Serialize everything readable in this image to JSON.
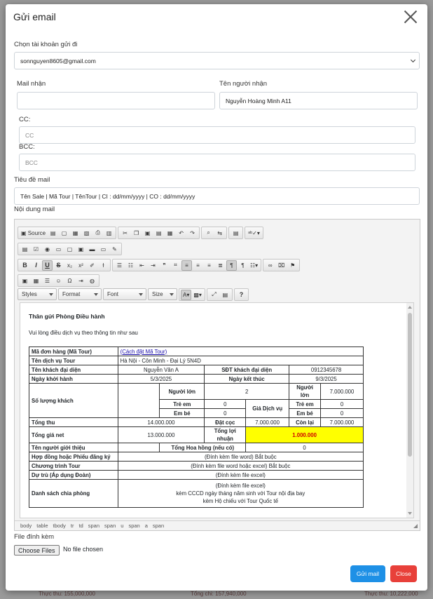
{
  "modal": {
    "title": "Gửi email"
  },
  "account": {
    "label": "Chọn tài khoản gửi đi",
    "value": "sonnguyen8605@gmail.com"
  },
  "to": {
    "label": "Mail nhận",
    "value": ""
  },
  "recipient_name": {
    "label": "Tên người nhận",
    "value": "Nguyễn Hoàng Minh A11"
  },
  "cc": {
    "label": "CC:",
    "placeholder": "CC"
  },
  "bcc": {
    "label": "BCC:",
    "placeholder": "BCC"
  },
  "subject": {
    "label": "Tiêu đề mail",
    "value": "Tên Sale | Mã Tour | TênTour | CI : dd/mm/yyyy | CO : dd/mm/yyyy"
  },
  "body_label": "Nội dung mail",
  "toolbar": {
    "source": "Source",
    "styles": "Styles",
    "format": "Format",
    "font": "Font",
    "size": "Size",
    "bold": "B",
    "italic": "I",
    "underline": "U",
    "strike": "S",
    "sub": "x₂",
    "sup": "x²",
    "help": "?"
  },
  "content": {
    "greeting": "Thân gửi Phòng Điều hành",
    "intro": "Vui lòng điều dịch vụ theo thông tin như sau",
    "rows": {
      "order_code_label": "Mã đơn hàng (Mã Tour)",
      "order_code_value": "(Cách đặt Mã Tour)",
      "service_name_label": "Tên dịch vụ Tour",
      "service_name_value": "Hà Nội - Côn Minh - Đại Lý 5N4D",
      "rep_label": "Tên khách đại diện",
      "rep_value": "Nguyễn Văn A",
      "phone_label": "SĐT khách đại diện",
      "phone_value": "0912345678",
      "start_label": "Ngày khởi hành",
      "start_value": "5/3/2025",
      "end_label": "Ngày kết thúc",
      "end_value": "9/3/2025",
      "guests_label": "Số lượng khách",
      "adult_label": "Người lớn",
      "adult_value": "2",
      "child_label": "Trẻ em",
      "child_value": "0",
      "infant_label": "Em bé",
      "infant_value": "0",
      "price_label": "Giá Dịch vụ",
      "price_adult_label": "Người lớn",
      "price_adult_value": "7.000.000",
      "price_child_label": "Trẻ em",
      "price_child_value": "0",
      "price_infant_label": "Em bé",
      "price_infant_value": "0",
      "total_label": "Tổng thu",
      "total_value": "14.000.000",
      "deposit_label": "Đặt cọc",
      "deposit_value": "7.000.000",
      "remain_label": "Còn lại",
      "remain_value": "7.000.000",
      "net_label": "Tổng giá net",
      "net_value": "13.000.000",
      "profit_label": "Tổng lợi nhuận",
      "profit_value": "1.000.000",
      "referrer_label": "Tên người giới thiệu",
      "commission_label": "Tổng Hoa hồng (nếu có)",
      "commission_value": "0",
      "contract_label": "Hợp đồng hoặc Phiếu đăng ký",
      "contract_value": "(Đính kèm file word) Bắt buộc",
      "program_label": "Chương trình Tour",
      "program_value": "(Đính kèm file word hoặc excel) Bắt buộc",
      "estimate_label": "Dự trù (Áp dụng Đoàn)",
      "estimate_value": "(Đính kèm file excel)",
      "rooming_label": "Danh sách chia phòng",
      "rooming_value_1": "(Đính kèm file excel)",
      "rooming_value_2": "kèm CCCD ngày tháng năm sinh với Tour nội địa bay",
      "rooming_value_3": "kèm Hộ chiếu với Tour Quốc tế"
    }
  },
  "pathbar": [
    "body",
    "table",
    "tbody",
    "tr",
    "td",
    "span",
    "span",
    "u",
    "span",
    "a",
    "span"
  ],
  "attachment": {
    "label": "File đính kèm",
    "button": "Choose Files",
    "status": "No file chosen"
  },
  "actions": {
    "send": "Gửi mail",
    "close": "Close"
  },
  "background": {
    "bottom_left": "Thực thu: 155,000,000",
    "bottom_mid": "Tổng chi: 157,940,000",
    "bottom_right": "Thực thu: 10,222,000"
  },
  "colors": {
    "primary": "#1e90e6",
    "danger": "#e8403a",
    "highlight": "#ffff00",
    "highlight_text": "#d00000"
  }
}
